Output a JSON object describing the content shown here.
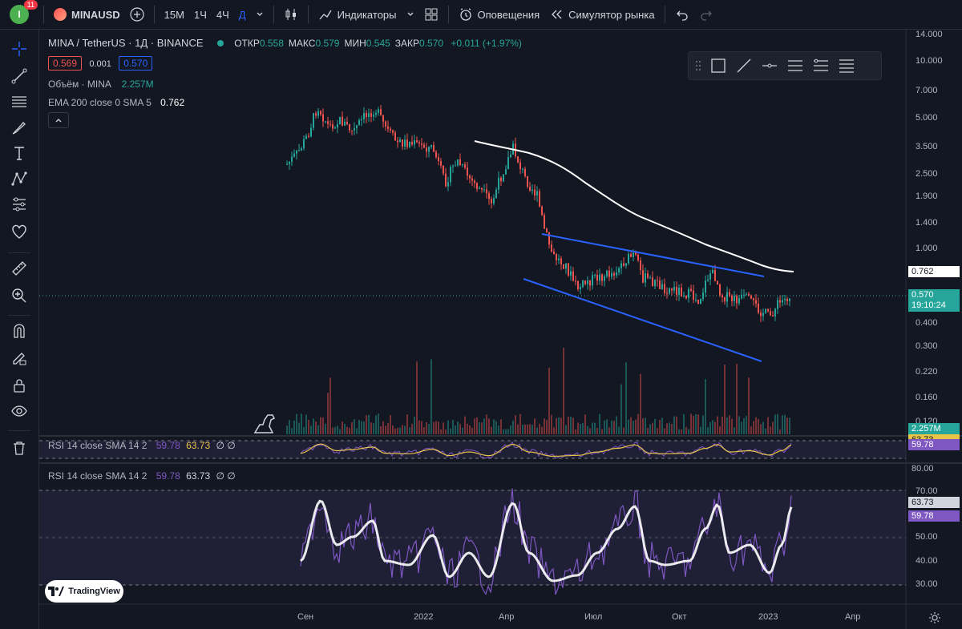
{
  "topbar": {
    "avatar_letter": "I",
    "notif_count": "11",
    "symbol": "MINAUSD",
    "intervals": [
      "15М",
      "1Ч",
      "4Ч",
      "Д"
    ],
    "active_interval": "Д",
    "indicators_label": "Индикаторы",
    "alerts_label": "Оповещения",
    "replay_label": "Симулятор рынка"
  },
  "legend": {
    "title": "MINA / TetherUS · 1Д · BINANCE",
    "ohlc": [
      {
        "k": "ОТКР",
        "v": "0.558"
      },
      {
        "k": "МАКС",
        "v": "0.579"
      },
      {
        "k": "МИН",
        "v": "0.545"
      },
      {
        "k": "ЗАКР",
        "v": "0.570"
      }
    ],
    "change": "+0.011 (+1.97%)",
    "bid": "0.569",
    "spread": "0.001",
    "ask": "0.570",
    "volume_label": "Объём · MINA",
    "volume_value": "2.257M",
    "ema_label": "EMA 200 close 0 SMA 5",
    "ema_value": "0.762",
    "rsi_label": "RSI 14 close SMA 14 2",
    "rsi_value": "59.78",
    "rsi_sma_value": "63.73",
    "rsi_extra": "∅ ∅"
  },
  "price_axis": [
    "14.000",
    "10.000",
    "7.000",
    "5.000",
    "3.500",
    "2.500",
    "1.900",
    "1.400",
    "1.000",
    "0.400",
    "0.300",
    "0.220",
    "0.160",
    "0.120"
  ],
  "price_tags": {
    "ema": "0.762",
    "last": "0.570",
    "countdown": "19:10:24",
    "volume": "2.257M",
    "rsi_small": "59.78",
    "rsi_small_hidden": "63.73",
    "rsi_axis_small": "80.00"
  },
  "rsi_axis": [
    "80.00",
    "70.00",
    "50.00",
    "40.00",
    "30.00"
  ],
  "rsi_tags": {
    "sma": "63.73",
    "rsi": "59.78"
  },
  "time_axis": [
    "Сен",
    "2022",
    "Апр",
    "Июл",
    "Окт",
    "2023",
    "Апр"
  ],
  "watermark": "TradingView",
  "colors": {
    "up": "#26a69a",
    "down": "#ef5350",
    "accent": "#2962ff",
    "rsi": "#7e57c2",
    "rsi_sma": "#ffffff",
    "ema": "#ffffff",
    "trend": "#2962ff"
  }
}
